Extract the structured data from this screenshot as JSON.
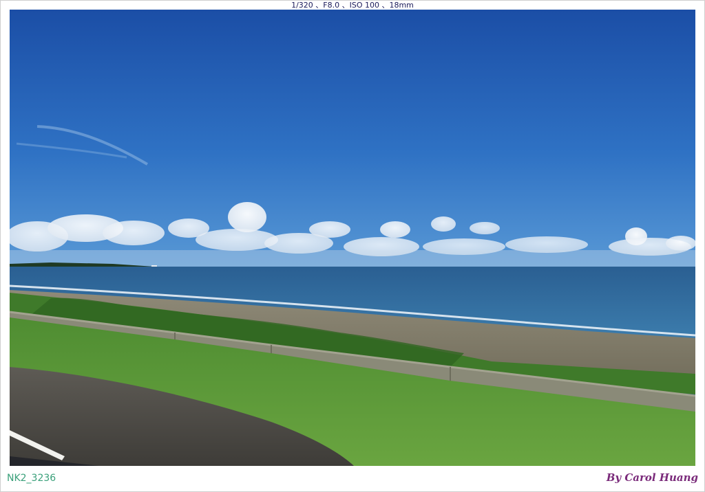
{
  "caption": {
    "exif": "1/320 、F8.0 、ISO 100 、18mm",
    "filename": "NK2_3236",
    "credit": "By Carol Huang"
  },
  "scene": {
    "sky_top_color": "#1a4fa8",
    "sky_bottom_color": "#4a92d4",
    "sea_color": "#2f6a9c",
    "grass_color": "#5a9a3a",
    "road_color": "#55534e"
  }
}
